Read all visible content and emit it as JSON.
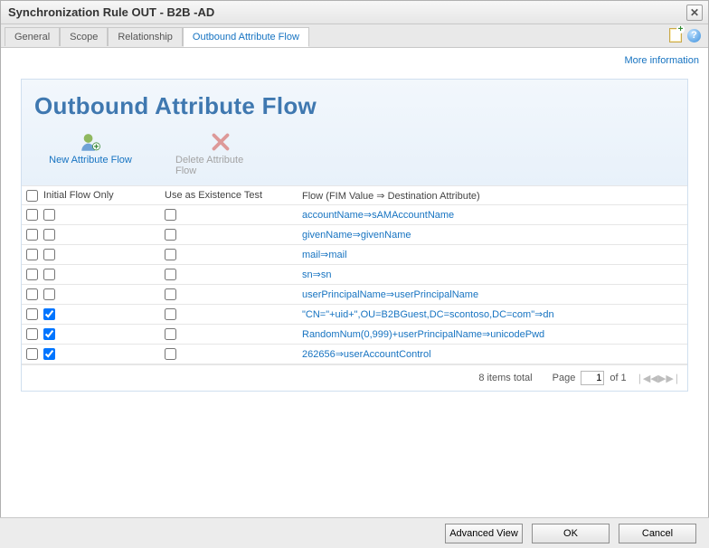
{
  "window": {
    "title": "Synchronization Rule OUT - B2B -AD"
  },
  "tabs": [
    {
      "label": "General"
    },
    {
      "label": "Scope"
    },
    {
      "label": "Relationship"
    },
    {
      "label": "Outbound Attribute Flow"
    }
  ],
  "active_tab_index": 3,
  "links": {
    "more_info": "More information"
  },
  "panel": {
    "title": "Outbound Attribute Flow",
    "new_flow_label": "New Attribute Flow",
    "delete_flow_label": "Delete Attribute Flow"
  },
  "grid": {
    "headers": {
      "initial": "Initial Flow Only",
      "existence": "Use as Existence Test",
      "flow": "Flow (FIM Value ⇒ Destination Attribute)"
    },
    "rows": [
      {
        "selected": false,
        "initial": false,
        "existence": false,
        "flow": "accountName⇒sAMAccountName"
      },
      {
        "selected": false,
        "initial": false,
        "existence": false,
        "flow": "givenName⇒givenName"
      },
      {
        "selected": false,
        "initial": false,
        "existence": false,
        "flow": "mail⇒mail"
      },
      {
        "selected": false,
        "initial": false,
        "existence": false,
        "flow": "sn⇒sn"
      },
      {
        "selected": false,
        "initial": false,
        "existence": false,
        "flow": "userPrincipalName⇒userPrincipalName"
      },
      {
        "selected": false,
        "initial": true,
        "existence": false,
        "flow": "\"CN=\"+uid+\",OU=B2BGuest,DC=scontoso,DC=com\"⇒dn"
      },
      {
        "selected": false,
        "initial": true,
        "existence": false,
        "flow": "RandomNum(0,999)+userPrincipalName⇒unicodePwd"
      },
      {
        "selected": false,
        "initial": true,
        "existence": false,
        "flow": "262656⇒userAccountControl"
      }
    ]
  },
  "paging": {
    "total_label": "8 items total",
    "page_label": "Page",
    "page_value": "1",
    "of_label": "of 1"
  },
  "buttons": {
    "advanced": "Advanced View",
    "ok": "OK",
    "cancel": "Cancel"
  }
}
